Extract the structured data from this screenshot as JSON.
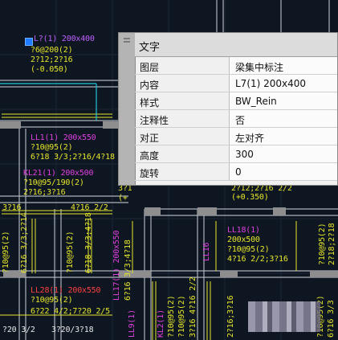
{
  "palette": {
    "section_title": "文字",
    "rows": [
      {
        "name": "图层",
        "value": "梁集中标注"
      },
      {
        "name": "内容",
        "value": "L7(1) 200x400"
      },
      {
        "name": "样式",
        "value": "BW_Rein"
      },
      {
        "name": "注释性",
        "value": "否"
      },
      {
        "name": "对正",
        "value": "左对齐"
      },
      {
        "name": "高度",
        "value": "300"
      },
      {
        "name": "旋转",
        "value": "0"
      }
    ]
  },
  "drawing": {
    "selected_note": {
      "l1": "L?(1) 200x400",
      "l2": "?6@200(2)",
      "l3": "2?12;2?16",
      "l4": "(-0.050)"
    },
    "ll1": {
      "l1": "LL1(1) 200x550",
      "l2": "?10@95(2)",
      "l3": "6?18 3/3;2?16/4?18"
    },
    "kl21": {
      "l1": "KL21(1) 200x500",
      "l2": "?10@95/190(2)",
      "l3": "2?16;3?16"
    },
    "partial_left": {
      "l1": "3?",
      "l2": "3?1",
      "l3": "(+"
    },
    "bottom_left": {
      "l1": "3?16",
      "l2": "4?16 2/2"
    },
    "right_upper": {
      "l1": "2?12;2?16 2/2",
      "l2": "(+0.350)"
    },
    "ll18": {
      "l1": "LL18(1)",
      "l2": "200x500",
      "l3": "?10@95(2)",
      "l4": "4?16 2/2;3?16"
    },
    "ll28": {
      "l1": "LL28(1) 200x550",
      "l2": "?10@95(2)",
      "l3": "6?22 4/2;7?20 2/5"
    },
    "bottom": {
      "l1": "?20 3/2",
      "l2": "3?20/3?18"
    },
    "vert_labels": {
      "v1": "?10@95(2)",
      "v2": "6?16 3/3;2?14",
      "v3": "?10@95(2)",
      "v4": "6?18 3/3;4?18",
      "v5": "LL17(1) 200x550",
      "v6": "6?16 3/3;4?18",
      "v7": "LL16",
      "v8": "?10@95(2)",
      "v9": "2?18;2?18",
      "v10": "LL9(1)",
      "v11": "?10@95(2)",
      "v12": "3?16 4?16 2/2",
      "v13": "KL2(1)",
      "v14": "?10@95(2)",
      "v15": "2?16;3?16",
      "v16": "?10@95(2)",
      "v17": "6?16 3/3"
    }
  },
  "colors": {
    "background": "#0e1622",
    "wall": "#8e8e8e",
    "rebar_line": "#e6e62a",
    "beam_label": "#e040e0",
    "beam_label_red": "#ff4040",
    "palette_bg": "#f0f0f0"
  }
}
